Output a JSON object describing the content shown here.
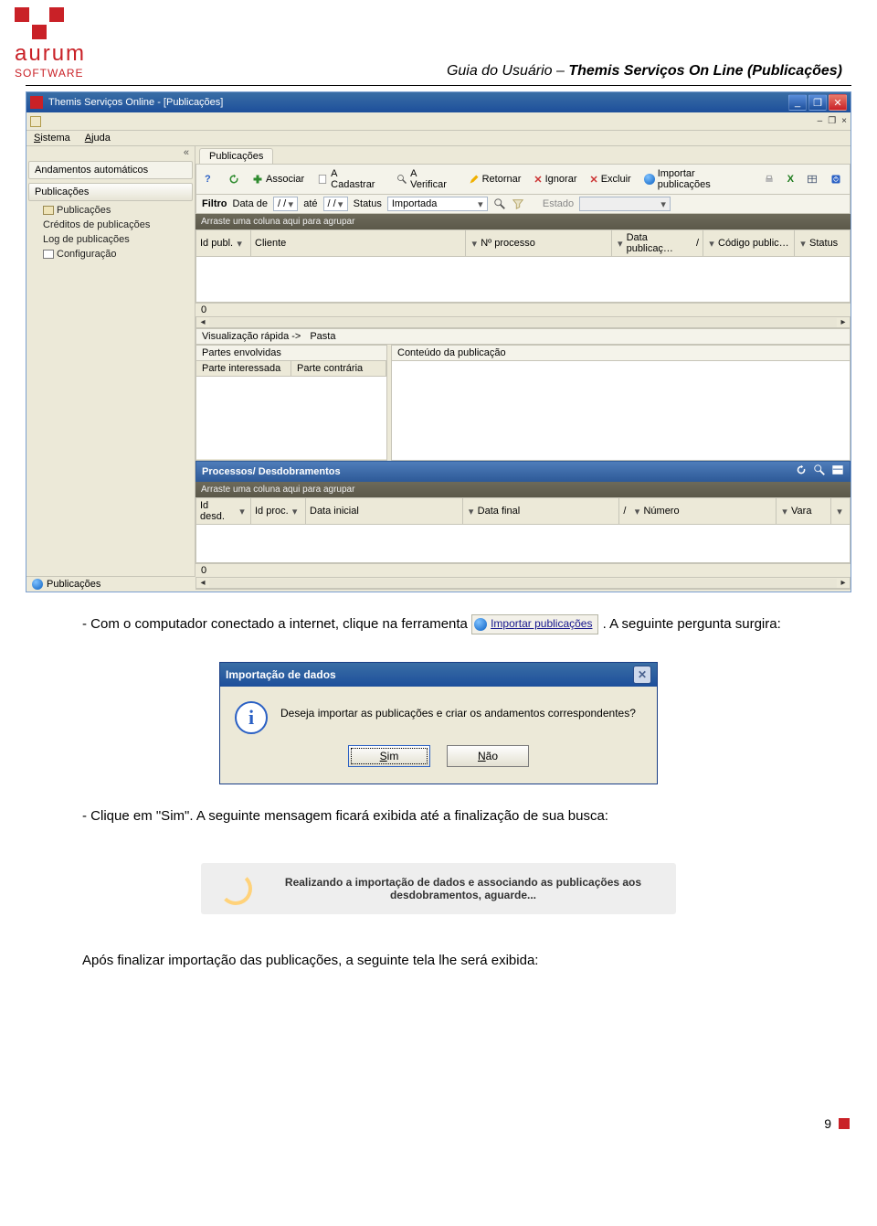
{
  "logo": {
    "word": "aurum",
    "sub": "SOFTWARE"
  },
  "doc_title_prefix": "Guia do Usuário – ",
  "doc_title_bold": "Themis Serviços On Line (Publicações)",
  "app": {
    "title": "Themis Serviços Online - [Publicações]",
    "window_controls": {
      "min": "_",
      "max": "❐",
      "close": "✕",
      "restore": "–",
      "sm_restore": "❐",
      "sm_close": "×"
    },
    "menu": {
      "sistema": "Sistema",
      "ajuda": "Ajuda"
    },
    "collapse_glyph": "«",
    "sidebar": {
      "item0": "Andamentos automáticos",
      "item1": "Publicações",
      "sub2": "Publicações",
      "sub3": "Créditos de publicações",
      "sub4": "Log de publicações",
      "sub5": "Configuração"
    },
    "tab_main": "Publicações",
    "toolbar": {
      "refresh": "",
      "associar": "Associar",
      "acadastrar": "A Cadastrar",
      "averificar": "A Verificar",
      "retornar": "Retornar",
      "ignorar": "Ignorar",
      "excluir": "Excluir",
      "importar": "Importar publicações"
    },
    "filter": {
      "filtro": "Filtro",
      "data_de": "Data de",
      "ate": "até",
      "placeholder_date": "/   /",
      "status": "Status",
      "status_val": "Importada",
      "estado_lbl": "Estado"
    },
    "group_hint": "Arraste uma coluna aqui para agrupar",
    "cols": {
      "id_publ": "Id publ.",
      "cliente": "Cliente",
      "nprocesso": "Nº processo",
      "data_publ": "Data publicaç…",
      "codigo_publ": "Código public…",
      "status": "Status"
    },
    "count0": "0",
    "quickview": {
      "label": "Visualização rápida ->",
      "pasta": "Pasta"
    },
    "panel_partes": "Partes envolvidas",
    "panel_conteudo": "Conteúdo da publicação",
    "parte_interessada": "Parte interessada",
    "parte_contraria": "Parte contrária",
    "section_desd": "Processos/ Desdobramentos",
    "cols2": {
      "id_desd": "Id desd.",
      "id_proc": "Id proc.",
      "data_ini": "Data inicial",
      "data_fin": "Data final",
      "numero": "Número",
      "vara": "Vara"
    },
    "slash_date": "/",
    "status_tab": "Publicações"
  },
  "para1_a": "- Com o computador conectado a internet, clique na ferramenta ",
  "para1_tool": "Importar publicações",
  "para1_b": ". A seguinte pergunta surgira:",
  "dialog": {
    "title": "Importação de dados",
    "msg": "Deseja importar as publicações e criar os andamentos correspondentes?",
    "yes": "Sim",
    "yes_u": "S",
    "no": "Não",
    "no_u": "N"
  },
  "para2": "- Clique em \"Sim\". A seguinte mensagem ficará exibida até a finalização de sua busca:",
  "loading": "Realizando a importação de dados e associando as publicações aos desdobramentos, aguarde...",
  "para3": "Após finalizar importação das publicações, a seguinte tela lhe será exibida:",
  "page_no": "9"
}
